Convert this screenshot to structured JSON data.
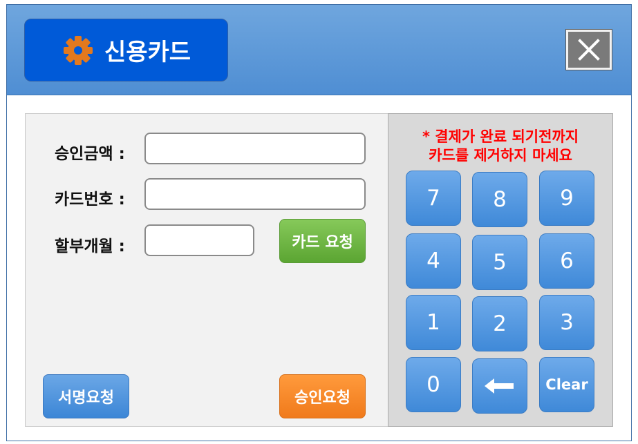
{
  "header": {
    "title": "신용카드",
    "gear_icon": "gear-icon",
    "close_icon": "close-icon",
    "colors": {
      "bar": "#5b9ad9",
      "title_box": "#005ad8",
      "gear": "#e2791e",
      "close": "#7a7a7a"
    }
  },
  "form": {
    "fields": [
      {
        "label": "승인금액 :",
        "value": ""
      },
      {
        "label": "카드번호 :",
        "value": ""
      },
      {
        "label": "할부개월 :",
        "value": ""
      }
    ],
    "card_request_label": "카드 요청",
    "signature_request_label": "서명요청",
    "approval_request_label": "승인요청"
  },
  "keypad": {
    "warning_line1": "* 결제가 완료 되기전까지",
    "warning_line2": "카드를 제거하지 마세요",
    "keys": [
      "7",
      "8",
      "9",
      "4",
      "5",
      "6",
      "1",
      "2",
      "3",
      "0",
      "backspace-arrow-icon",
      "Clear"
    ],
    "clear_label": "Clear"
  }
}
